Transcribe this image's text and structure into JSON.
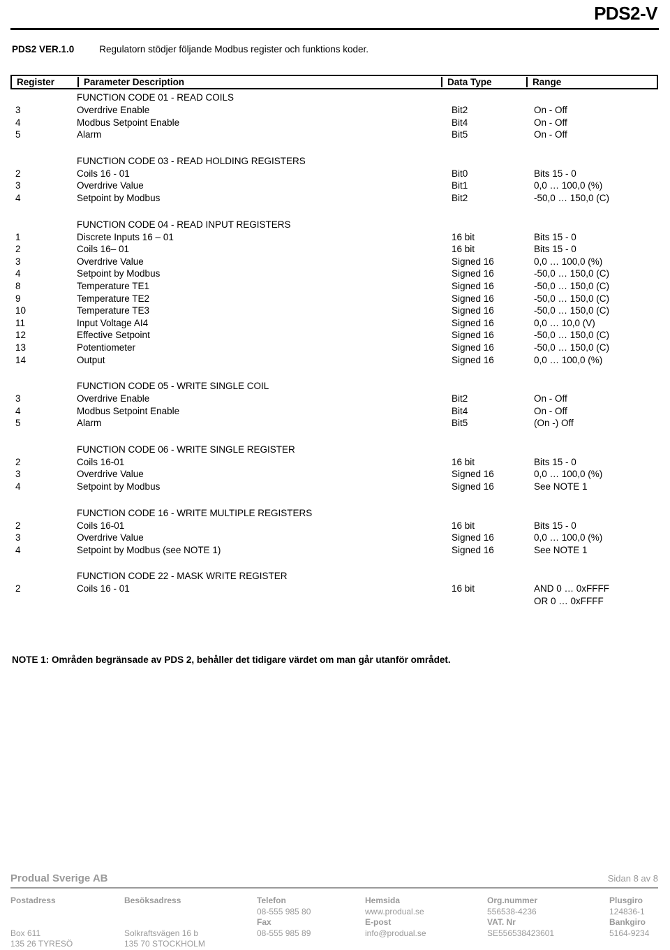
{
  "header": {
    "doc_title": "PDS2-V",
    "version_label": "PDS2 VER.1.0",
    "version_description": "Regulatorn stödjer följande Modbus register och funktions koder."
  },
  "table": {
    "columns": {
      "register": "Register",
      "parameter": "Parameter Description",
      "data_type": "Data Type",
      "range": "Range"
    },
    "sections": [
      {
        "title": "FUNCTION CODE 01 - READ COILS",
        "rows": [
          {
            "register": "3",
            "parameter": "Overdrive Enable",
            "data_type": "Bit2",
            "range": "On - Off"
          },
          {
            "register": "4",
            "parameter": "Modbus Setpoint Enable",
            "data_type": "Bit4",
            "range": "On - Off"
          },
          {
            "register": "5",
            "parameter": "Alarm",
            "data_type": "Bit5",
            "range": "On - Off"
          }
        ]
      },
      {
        "title": "FUNCTION CODE 03 - READ HOLDING REGISTERS",
        "rows": [
          {
            "register": "2",
            "parameter": "Coils 16 - 01",
            "data_type": "Bit0",
            "range": "Bits 15 - 0"
          },
          {
            "register": "3",
            "parameter": "Overdrive Value",
            "data_type": "Bit1",
            "range": "0,0 … 100,0 (%)"
          },
          {
            "register": "4",
            "parameter": "Setpoint by Modbus",
            "data_type": "Bit2",
            "range": "-50,0 … 150,0 (C)"
          }
        ]
      },
      {
        "title": "FUNCTION CODE 04 - READ INPUT REGISTERS",
        "rows": [
          {
            "register": "1",
            "parameter": "Discrete Inputs 16 – 01",
            "data_type": "16 bit",
            "range": "Bits 15 - 0"
          },
          {
            "register": "2",
            "parameter": "Coils 16– 01",
            "data_type": "16 bit",
            "range": "Bits 15 - 0"
          },
          {
            "register": "3",
            "parameter": "Overdrive Value",
            "data_type": "Signed 16",
            "range": "0,0 … 100,0 (%)"
          },
          {
            "register": "4",
            "parameter": "Setpoint by Modbus",
            "data_type": "Signed 16",
            "range": "-50,0 … 150,0 (C)"
          },
          {
            "register": "8",
            "parameter": "Temperature TE1",
            "data_type": "Signed 16",
            "range": "-50,0 … 150,0 (C)"
          },
          {
            "register": "9",
            "parameter": "Temperature TE2",
            "data_type": "Signed 16",
            "range": "-50,0 … 150,0 (C)"
          },
          {
            "register": "10",
            "parameter": "Temperature TE3",
            "data_type": "Signed 16",
            "range": "-50,0 … 150,0 (C)"
          },
          {
            "register": "11",
            "parameter": "Input Voltage AI4",
            "data_type": "Signed 16",
            "range": "0,0 … 10,0 (V)"
          },
          {
            "register": "12",
            "parameter": "Effective Setpoint",
            "data_type": "Signed 16",
            "range": "-50,0 … 150,0 (C)"
          },
          {
            "register": "13",
            "parameter": "Potentiometer",
            "data_type": "Signed 16",
            "range": "-50,0 … 150,0 (C)"
          },
          {
            "register": "14",
            "parameter": "Output",
            "data_type": "Signed 16",
            "range": "0,0 … 100,0 (%)"
          }
        ]
      },
      {
        "title": "FUNCTION CODE 05 - WRITE SINGLE COIL",
        "rows": [
          {
            "register": "3",
            "parameter": "Overdrive Enable",
            "data_type": "Bit2",
            "range": "On - Off"
          },
          {
            "register": "4",
            "parameter": "Modbus Setpoint Enable",
            "data_type": "Bit4",
            "range": "On - Off"
          },
          {
            "register": "5",
            "parameter": "Alarm",
            "data_type": "Bit5",
            "range": "(On -) Off"
          }
        ]
      },
      {
        "title": "FUNCTION CODE 06 - WRITE SINGLE REGISTER",
        "rows": [
          {
            "register": "2",
            "parameter": "Coils 16-01",
            "data_type": "16 bit",
            "range": "Bits 15 - 0"
          },
          {
            "register": "3",
            "parameter": "Overdrive Value",
            "data_type": "Signed 16",
            "range": "0,0 … 100,0 (%)"
          },
          {
            "register": "4",
            "parameter": "Setpoint by Modbus",
            "data_type": "Signed 16",
            "range": "See NOTE 1"
          }
        ]
      },
      {
        "title": "FUNCTION CODE 16 - WRITE MULTIPLE REGISTERS",
        "rows": [
          {
            "register": "2",
            "parameter": "Coils 16-01",
            "data_type": "16 bit",
            "range": "Bits 15 - 0"
          },
          {
            "register": "3",
            "parameter": "Overdrive Value",
            "data_type": "Signed 16",
            "range": "0,0 … 100,0 (%)"
          },
          {
            "register": "4",
            "parameter": "Setpoint by Modbus (see NOTE 1)",
            "data_type": "Signed 16",
            "range": "See NOTE 1"
          }
        ]
      },
      {
        "title": "FUNCTION CODE 22 - MASK WRITE REGISTER",
        "rows": [
          {
            "register": "2",
            "parameter": "Coils 16 - 01",
            "data_type": "16 bit",
            "range": "AND 0 … 0xFFFF"
          },
          {
            "register": "",
            "parameter": "",
            "data_type": "",
            "range": "OR 0 …  0xFFFF",
            "continuation": true
          }
        ]
      }
    ]
  },
  "note": "NOTE 1: Områden begränsade av PDS 2, behåller det tidigare värdet om man går utanför området.",
  "footer": {
    "company": "Produal Sverige AB",
    "page": "Sidan 8 av 8",
    "columns": [
      {
        "heading": "Postadress",
        "line1": "",
        "heading2": "",
        "line2": "Box 611",
        "line3": "135 26  TYRESÖ"
      },
      {
        "heading": "Besöksadress",
        "line1": "",
        "heading2": "",
        "line2": "Solkraftsvägen 16 b",
        "line3": "135 70  STOCKHOLM"
      },
      {
        "heading": "Telefon",
        "line1": "08-555 985 80",
        "heading2": "Fax",
        "line2": "08-555 985 89",
        "line3": ""
      },
      {
        "heading": "Hemsida",
        "line1": "www.produal.se",
        "heading2": "E-post",
        "line2": "info@produal.se",
        "line3": ""
      },
      {
        "heading": "Org.nummer",
        "line1": "556538-4236",
        "heading2": "VAT. Nr",
        "line2": "SE556538423601",
        "line3": ""
      },
      {
        "heading": "Plusgiro",
        "line1": "124836-1",
        "heading2": "Bankgiro",
        "line2": "5164-9234",
        "line3": ""
      }
    ]
  }
}
